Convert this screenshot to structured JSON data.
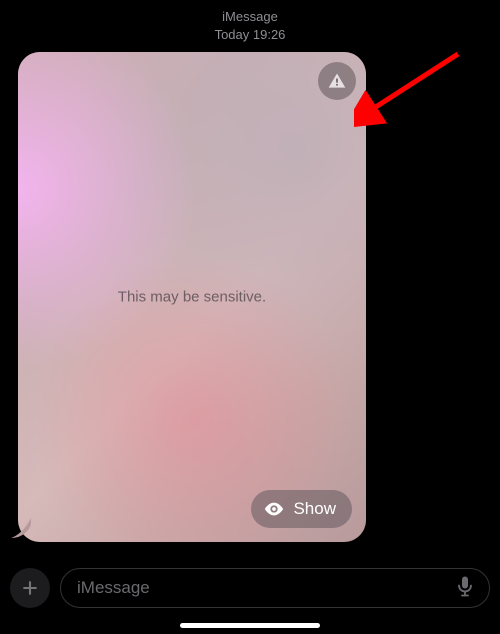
{
  "header": {
    "service": "iMessage",
    "timestamp": "Today 19:26"
  },
  "message": {
    "sensitive_label": "This may be sensitive.",
    "show_label": "Show"
  },
  "composer": {
    "placeholder": "iMessage"
  },
  "annotation": {
    "arrow_color": "#ff0000"
  }
}
